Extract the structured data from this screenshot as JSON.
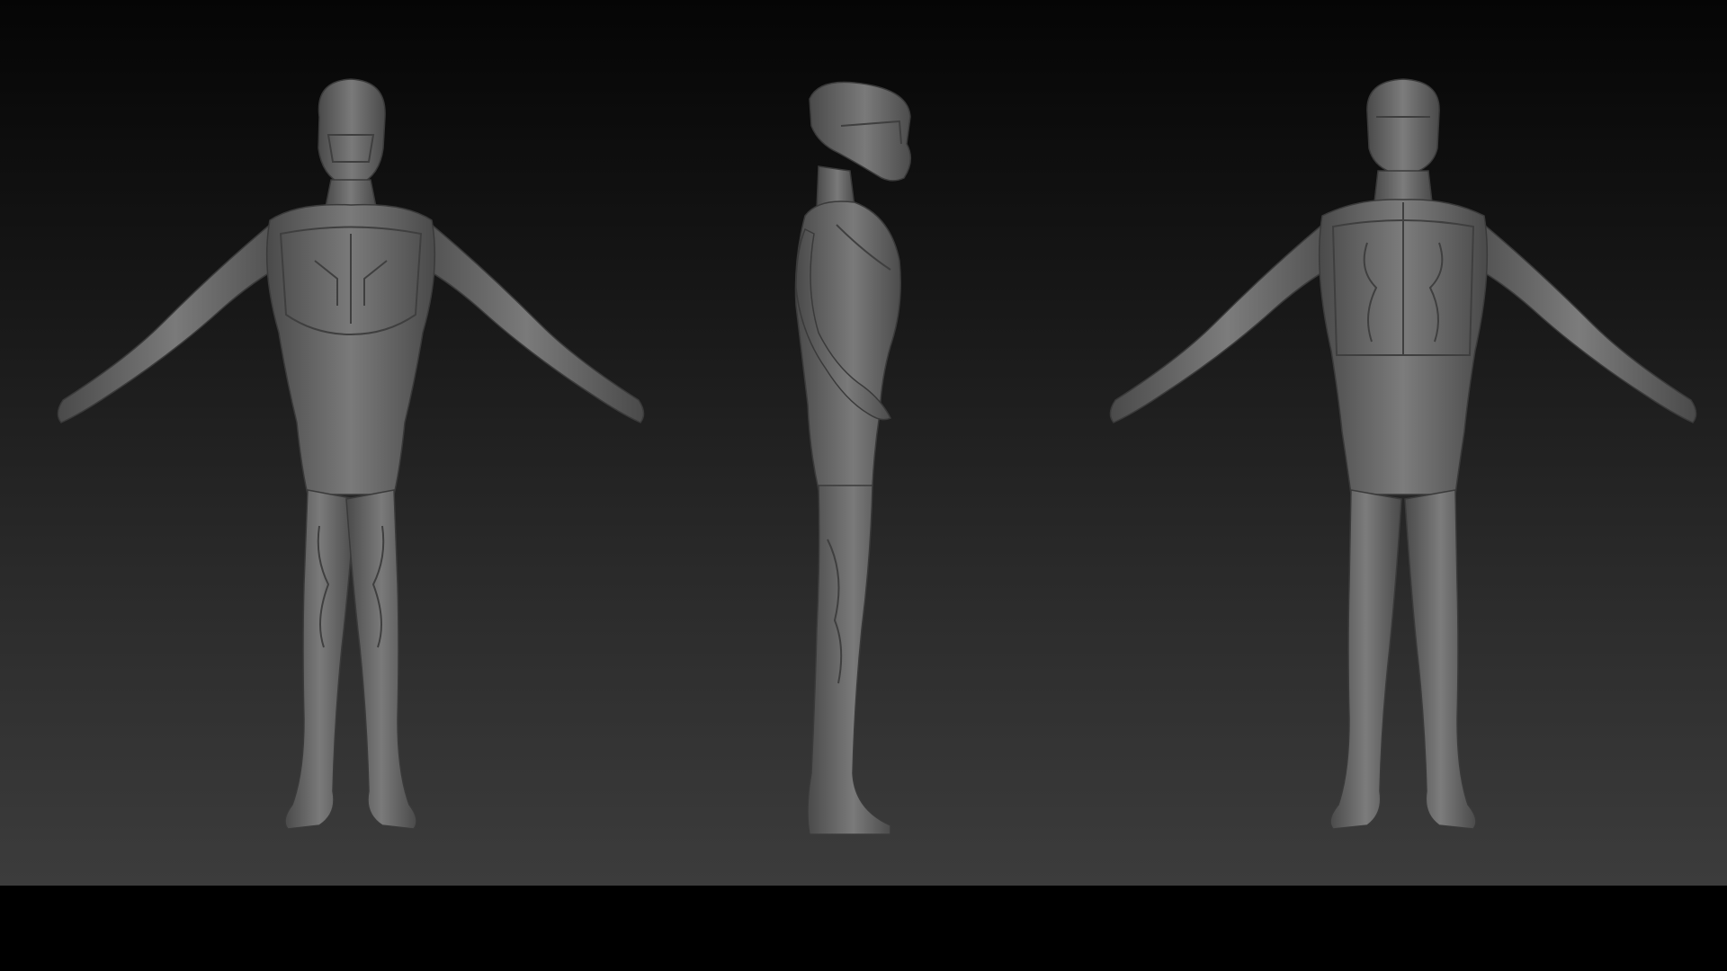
{
  "scene": {
    "background_top": "#050505",
    "background_bottom": "#3c3c3c",
    "letterbox": "#000000",
    "model_color": "#6e6e6e",
    "model_shadow": "#3f3f3f",
    "model_highlight": "#8c8c8c"
  },
  "views": [
    {
      "view": "front"
    },
    {
      "view": "side"
    },
    {
      "view": "back"
    }
  ]
}
